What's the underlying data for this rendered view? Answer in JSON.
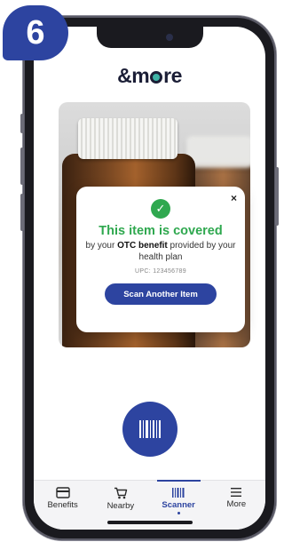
{
  "step": {
    "number": "6"
  },
  "app": {
    "brand_prefix": "&m",
    "brand_suffix": "re"
  },
  "modal": {
    "close_label": "×",
    "title": "This item is covered",
    "desc_part1": "by your ",
    "desc_bold": "OTC benefit",
    "desc_part2": " provided by your health plan",
    "upc": "UPC: 123456789",
    "button_label": "Scan Another Item"
  },
  "nav": {
    "items": [
      {
        "label": "Benefits",
        "icon": "card-icon"
      },
      {
        "label": "Nearby",
        "icon": "cart-icon"
      },
      {
        "label": "Scanner",
        "icon": "barcode-icon",
        "active": true
      },
      {
        "label": "More",
        "icon": "menu-icon"
      }
    ]
  },
  "colors": {
    "primary": "#2d44a0",
    "success": "#2fa84f",
    "accent": "#3fb3a6"
  }
}
